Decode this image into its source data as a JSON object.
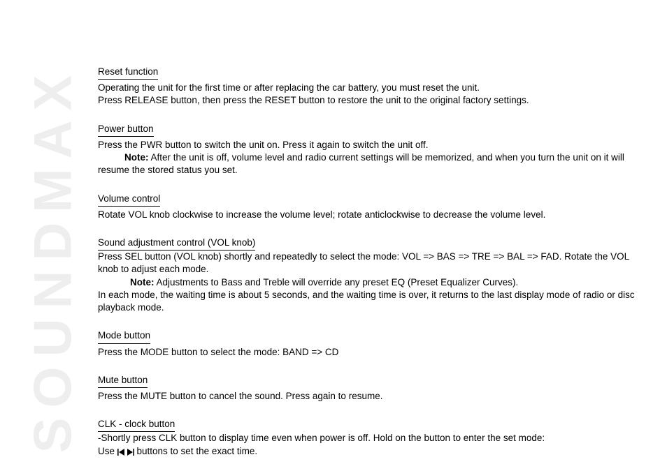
{
  "brand": "SOUNDMAX",
  "sections": {
    "reset": {
      "title": "Reset function",
      "lines": [
        "Operating the unit for the first time or after replacing the car battery, you must reset the unit.",
        "Press RELEASE button, then press the RESET button to restore the unit to the original factory settings."
      ]
    },
    "power": {
      "title": "Power button",
      "line1": "Press the PWR button to switch the unit on. Press it again to switch the unit off.",
      "note_label": "Note:",
      "note_text": " After the unit is off, volume level and radio current settings will be memorized, and when you turn the unit on it will resume the stored status you set."
    },
    "volume": {
      "title": "Volume control",
      "line1": "Rotate VOL knob clockwise to increase the volume level; rotate anticlockwise to decrease the volume level."
    },
    "sound": {
      "title": "Sound adjustment control (VOL knob)",
      "line1": "Press SEL button (VOL knob) shortly and repeatedly to select the mode: VOL => BAS => TRE => BAL => FAD. Rotate the VOL knob to adjust each mode.",
      "note_label": "Note:",
      "note_text": " Adjustments to Bass and Treble will override any preset EQ (Preset Equalizer Curves).",
      "line3": "In each mode, the waiting time is about 5 seconds, and the waiting time is over, it returns to the last display mode of radio or disc playback mode."
    },
    "mode": {
      "title": "Mode button",
      "line1": "Press the MODE button to select the mode: BAND => CD"
    },
    "mute": {
      "title": "Mute button",
      "line1": "Press the MUTE button to cancel the sound. Press again to resume."
    },
    "clock": {
      "title_leading": "CLK ",
      "title_underlined": "- clock button",
      "line1": "Shortly press CLK button to display time even when power is off. Hold on the button to enter the set mode:",
      "line2_prefix": "Use ",
      "line2_suffix": " buttons to set the exact time."
    }
  }
}
